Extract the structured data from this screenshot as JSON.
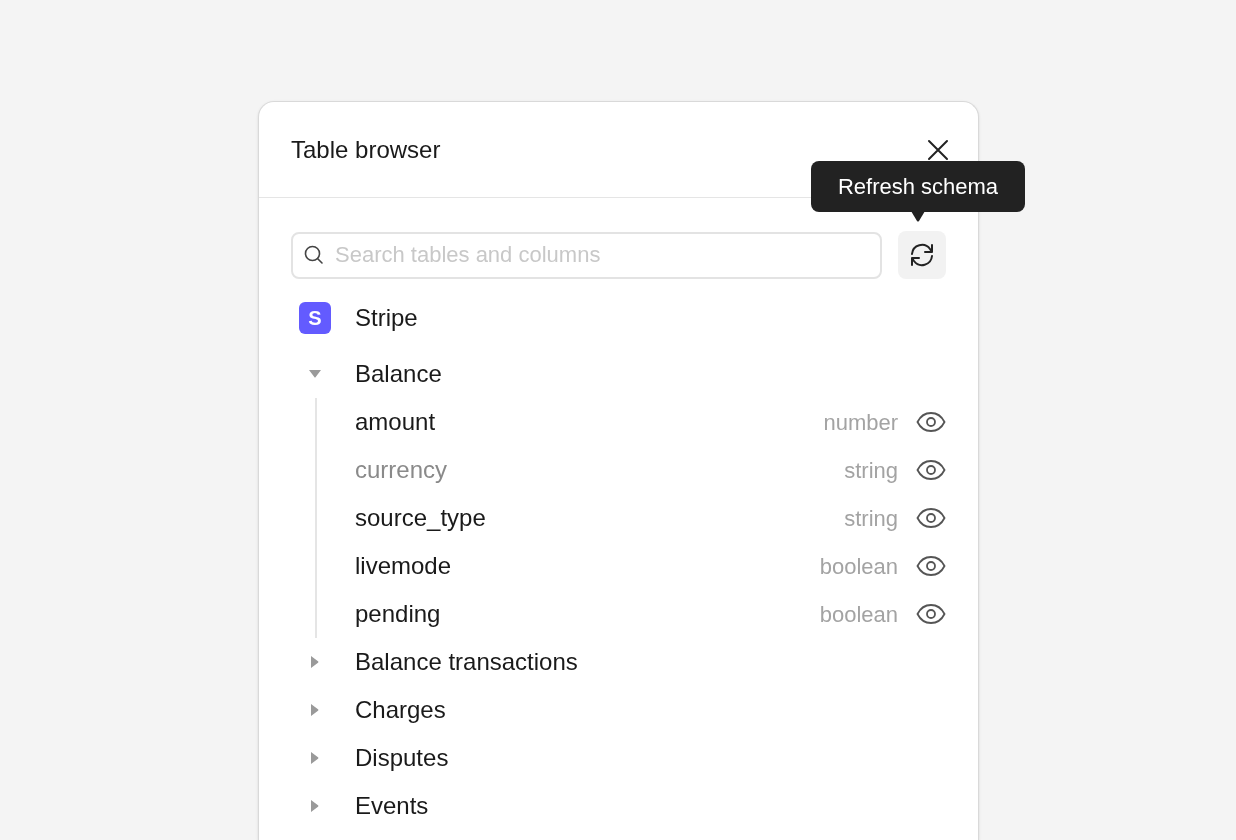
{
  "dialog": {
    "title": "Table browser"
  },
  "tooltip": {
    "text": "Refresh schema"
  },
  "search": {
    "placeholder": "Search tables and columns"
  },
  "source": {
    "name": "Stripe",
    "logo_letter": "S",
    "children": [
      {
        "name": "Balance",
        "expanded": true,
        "children": [
          {
            "name": "amount",
            "type": "number",
            "disabled": false
          },
          {
            "name": "currency",
            "type": "string",
            "disabled": true
          },
          {
            "name": "source_type",
            "type": "string",
            "disabled": false
          },
          {
            "name": "livemode",
            "type": "boolean",
            "disabled": false
          },
          {
            "name": "pending",
            "type": "boolean",
            "disabled": false
          }
        ]
      },
      {
        "name": "Balance transactions",
        "expanded": false
      },
      {
        "name": "Charges",
        "expanded": false
      },
      {
        "name": "Disputes",
        "expanded": false
      },
      {
        "name": "Events",
        "expanded": false
      }
    ]
  }
}
